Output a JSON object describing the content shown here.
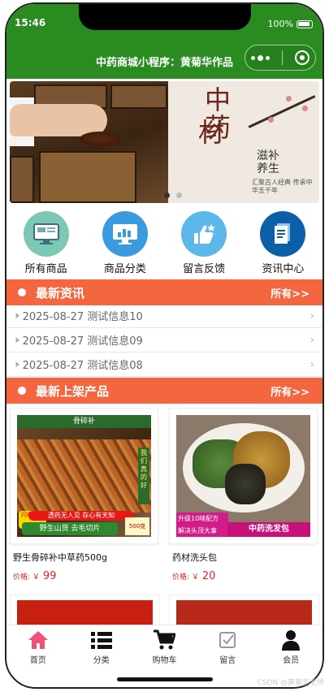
{
  "status": {
    "time": "15:46",
    "battery": "100%"
  },
  "nav": {
    "title": "中药商城小程序：黄菊华作品"
  },
  "banner": {
    "line1": "中药",
    "line2": "材",
    "side_text": "滋补养生",
    "small_text": "汇聚古人经典 传承中华五千年"
  },
  "categories": [
    {
      "label": "所有商品",
      "icon": "monitor-icon"
    },
    {
      "label": "商品分类",
      "icon": "chart-screen-icon"
    },
    {
      "label": "留言反馈",
      "icon": "thumbs-up-icon"
    },
    {
      "label": "资讯中心",
      "icon": "document-icon"
    }
  ],
  "news_section": {
    "title": "最新资讯",
    "more": "所有>>"
  },
  "news": [
    {
      "text": "2025-08-27 测试信息10"
    },
    {
      "text": "2025-08-27 测试信息09"
    },
    {
      "text": "2025-08-27 测试信息08"
    }
  ],
  "product_section": {
    "title": "最新上架产品",
    "more": "所有>>"
  },
  "products": [
    {
      "name": "野生骨碎补中草药500g",
      "price_label": "价格: ￥",
      "price": "99",
      "img_text": {
        "top": "骨碎补",
        "side": "我们真的好",
        "bottom1": "透药无人见 存心有天知",
        "bottom2": "野生山货 去毛切片",
        "badge": "500克",
        "tag": "闪电发货"
      }
    },
    {
      "name": "药材洗头包",
      "price_label": "价格: ￥",
      "price": "20",
      "img_text": {
        "banner1": "升级10味配方",
        "banner2": "解决头顶大事",
        "right": "中药洗发包"
      }
    }
  ],
  "tabs": [
    {
      "label": "首页",
      "icon": "home-icon"
    },
    {
      "label": "分类",
      "icon": "list-icon"
    },
    {
      "label": "购物车",
      "icon": "cart-icon"
    },
    {
      "label": "留言",
      "icon": "checkbox-icon"
    },
    {
      "label": "会员",
      "icon": "user-icon"
    }
  ],
  "watermark": "CSDN @黄菊华老师",
  "colors": {
    "header": "#2a8c20",
    "section": "#f36640",
    "price": "#e02020",
    "home_active": "#f0507a"
  }
}
